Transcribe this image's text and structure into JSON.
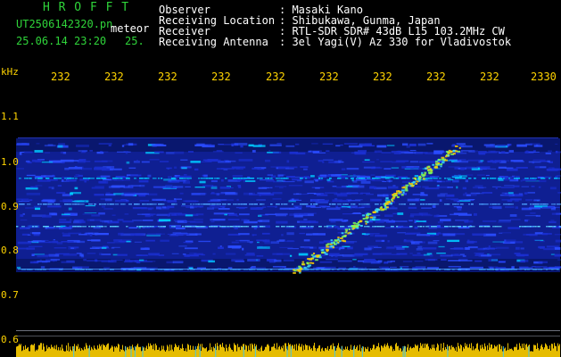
{
  "header": {
    "brand": "H R O F F T",
    "filename": "UT2506142320.pn",
    "type_tag": "meteor",
    "datetime": "25.06.14 23:20",
    "short_code": "25.",
    "info": [
      {
        "label": "Observer",
        "value": ": Masaki Kano"
      },
      {
        "label": "Receiving Location",
        "value": ": Shibukawa, Gunma, Japan"
      },
      {
        "label": "Receiver",
        "value": ": RTL-SDR SDR# 43dB L15 103.2MHz CW"
      },
      {
        "label": "Receiving Antenna",
        "value": ": 3el Yagi(V) Az 330 for Vladivostok"
      }
    ]
  },
  "y_axis": {
    "unit": "kHz",
    "ticks": [
      "1.1",
      "1.0",
      "0.9",
      "0.8",
      "0.7",
      "0.6"
    ]
  },
  "x_axis": {
    "ticks": [
      "232",
      "232",
      "232",
      "232",
      "232",
      "232",
      "232",
      "232",
      "232",
      "2330"
    ]
  },
  "colors": {
    "background": "#000000",
    "brand": "#2fd43a",
    "label": "#ffd400",
    "text": "#ffffff",
    "signal_low": "#1a2fd0",
    "signal_mid": "#00c8ff",
    "signal_high": "#ffd000"
  }
}
